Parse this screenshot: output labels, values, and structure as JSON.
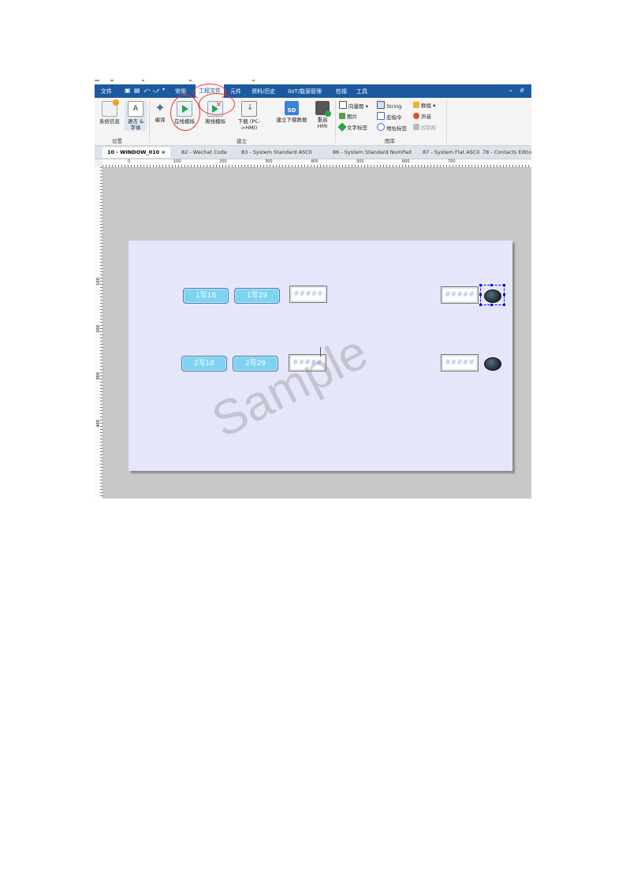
{
  "menu": {
    "items": [
      "文件",
      "常用",
      "工程文件",
      "元件",
      "资料/历史",
      "IIoT/能源管理",
      "检视",
      "工具"
    ],
    "active": "工程文件",
    "right_icons": [
      "minimize-icon",
      "help-icon"
    ]
  },
  "ribbon": {
    "settings": {
      "group": "设置",
      "items": [
        "系统信息",
        "语言 & 字体"
      ]
    },
    "build": {
      "group": "建立",
      "items": [
        "编译",
        "在线模拟",
        "离线模拟",
        "下载 (PC->HMI)",
        "建立下载数据",
        "重启 HMI"
      ]
    },
    "library": {
      "group": "图库",
      "items": [
        "向量图",
        "String",
        "群组",
        "图片",
        "宏指令",
        "声音",
        "文字标签",
        "地址标签",
        "控制权"
      ]
    }
  },
  "tabs": [
    "10 - WINDOW_010",
    "82 - Wechat Code",
    "83 - System Standard ASCII",
    "86 - System Standard NumPad",
    "87 - System Flat ASCII",
    "78 - Contacts Editor"
  ],
  "active_tab": "10 - WINDOW_010",
  "ruler": {
    "h": [
      "0",
      "100",
      "200",
      "300",
      "400",
      "500",
      "600",
      "700"
    ],
    "v": [
      "100",
      "200",
      "300",
      "400"
    ]
  },
  "canvas": {
    "buttons": [
      "1写18",
      "1写29",
      "2写18",
      "2写29"
    ],
    "displays": [
      "#####",
      "#####",
      "#####",
      "#####"
    ]
  },
  "watermark": "Sample",
  "colors": {
    "menubar": "#1b5aa0",
    "canvas": "#e6e6fa",
    "button": "#7fd3f2",
    "annotation": "#e33333"
  }
}
